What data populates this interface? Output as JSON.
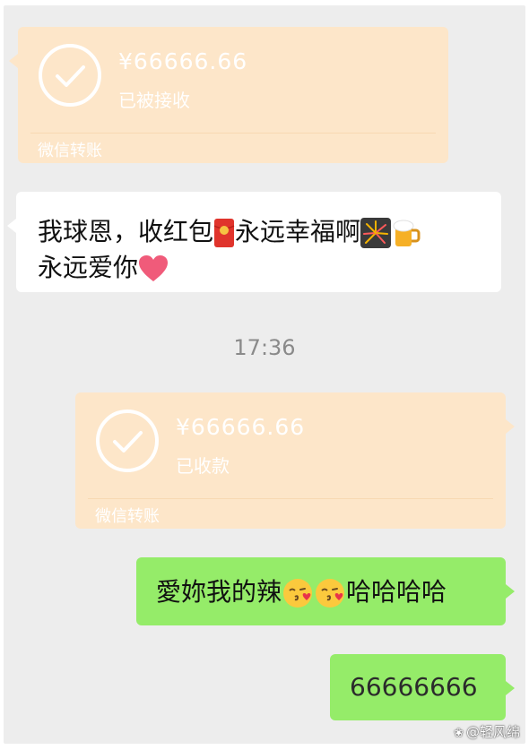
{
  "transfers": [
    {
      "amount": "¥66666.66",
      "status": "已被接收",
      "brand": "微信转账"
    },
    {
      "amount": "¥66666.66",
      "status": "已收款",
      "brand": "微信转账"
    }
  ],
  "messages": {
    "incoming": {
      "line1_part1": "我球恩，收红包",
      "line1_part2": "永远幸福啊",
      "line2": "永远爱你"
    },
    "timestamp": "17:36",
    "outgoing1": {
      "part1": "愛妳我的辣",
      "part2": "哈哈哈哈"
    },
    "outgoing2": {
      "text": "66666666"
    }
  },
  "watermark": {
    "text": "@轻风绵"
  },
  "colors": {
    "chat_background": "#ededed",
    "transfer_card": "#fde6c9",
    "incoming_bubble": "#ffffff",
    "outgoing_bubble": "#95ec69"
  }
}
